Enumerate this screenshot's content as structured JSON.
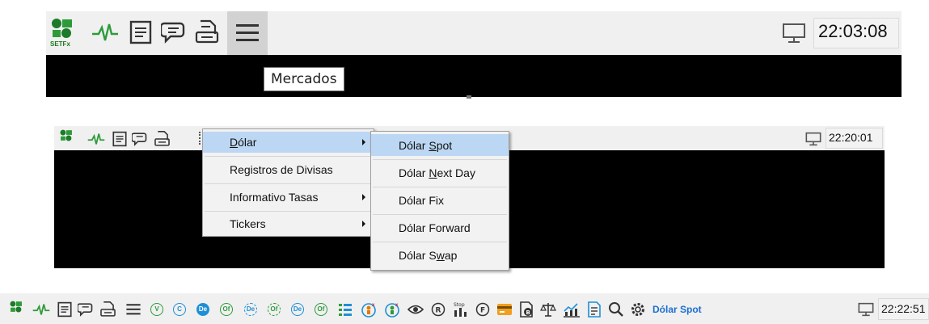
{
  "panel1": {
    "clock": "22:03:08",
    "tooltip": "Mercados",
    "logo_text": "SETFx"
  },
  "panel2": {
    "clock": "22:20:01",
    "logo_text": "SETFx",
    "menu": [
      {
        "pre": "",
        "ul": "D",
        "post": "ólar",
        "submenu": true,
        "highlighted": true
      },
      {
        "pre": "Registros de Divisas",
        "ul": "",
        "post": "",
        "submenu": false,
        "highlighted": false
      },
      {
        "pre": "Informativo Tasas",
        "ul": "",
        "post": "",
        "submenu": true,
        "highlighted": false
      },
      {
        "pre": "Tickers",
        "ul": "",
        "post": "",
        "submenu": true,
        "highlighted": false
      }
    ],
    "submenu": [
      {
        "pre": "Dólar ",
        "ul": "S",
        "post": "pot",
        "highlighted": true
      },
      {
        "pre": "Dólar ",
        "ul": "N",
        "post": "ext Day",
        "highlighted": false
      },
      {
        "pre": "Dólar Fix",
        "ul": "",
        "post": "",
        "highlighted": false
      },
      {
        "pre": "Dólar Forward",
        "ul": "",
        "post": "",
        "highlighted": false
      },
      {
        "pre": "Dólar S",
        "ul": "w",
        "post": "ap",
        "highlighted": false
      }
    ]
  },
  "panel3": {
    "clock": "22:22:51",
    "active_label": "Dólar Spot",
    "logo_text": "SETFx",
    "icons": [
      {
        "name": "v-circle-icon",
        "glyph": "V"
      },
      {
        "name": "c-circle-icon",
        "glyph": "C"
      },
      {
        "name": "de-circle-icon",
        "glyph": "De"
      },
      {
        "name": "of-circle-icon",
        "glyph": "Of"
      },
      {
        "name": "de-refresh-icon",
        "glyph": "De"
      },
      {
        "name": "of-refresh-icon",
        "glyph": "Of"
      },
      {
        "name": "de-cancel-icon",
        "glyph": "De"
      },
      {
        "name": "of-cancel-icon",
        "glyph": "Of"
      }
    ]
  },
  "colors": {
    "toolbar_bg": "#f0f0f0",
    "menu_highlight": "#bcd7f3",
    "icon_green": "#2e9b3a",
    "icon_blue": "#1e8fd6",
    "label_blue": "#1b6fd0"
  }
}
